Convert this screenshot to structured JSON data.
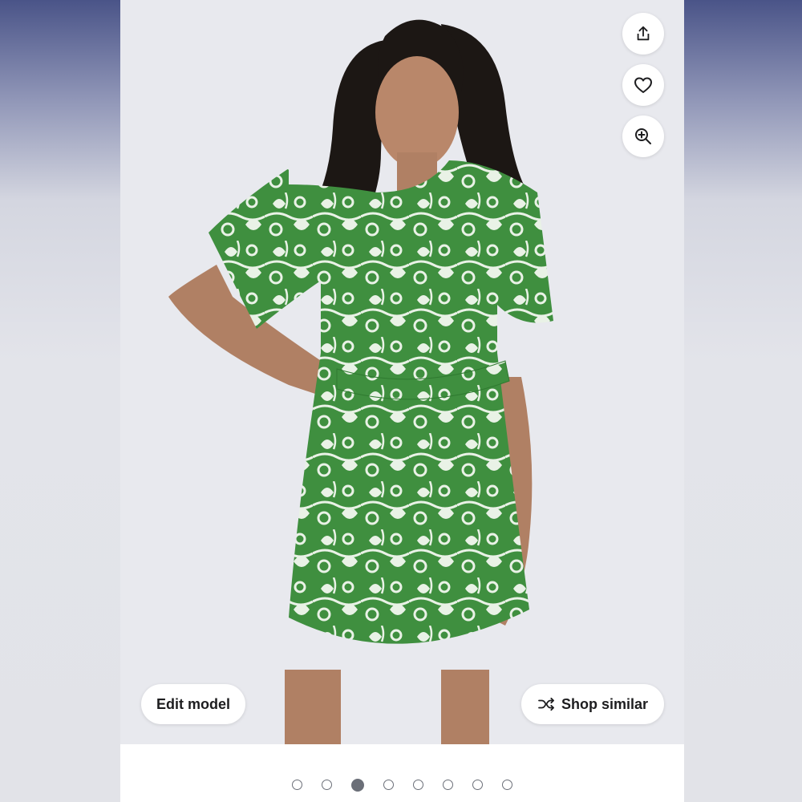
{
  "actions": {
    "share_icon": "share-icon",
    "favorite_icon": "heart-icon",
    "zoom_icon": "zoom-in-icon"
  },
  "buttons": {
    "edit_model": "Edit model",
    "shop_similar": "Shop similar",
    "shop_similar_icon": "shuffle-icon"
  },
  "carousel": {
    "total": 8,
    "current": 3
  },
  "product_image": {
    "description_colors": {
      "dress_primary": "#3f8f3f",
      "dress_pattern": "#e9f2e6",
      "background": "#e8e9ee"
    }
  }
}
